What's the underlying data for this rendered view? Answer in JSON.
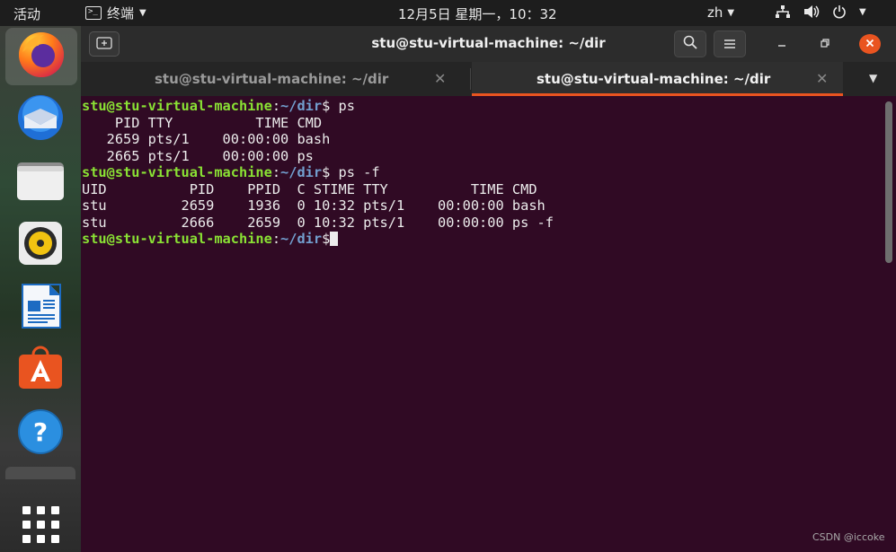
{
  "topbar": {
    "activities": "活动",
    "app_name": "终端",
    "clock": "12月5日 星期一，10：32",
    "language": "zh"
  },
  "dock": {
    "items": [
      "firefox-icon",
      "thunderbird-icon",
      "files-icon",
      "rhythmbox-icon",
      "libreoffice-writer-icon",
      "ubuntu-software-icon",
      "help-icon"
    ]
  },
  "window": {
    "title": "stu@stu-virtual-machine: ~/dir",
    "tabs": [
      {
        "label": "stu@stu-virtual-machine: ~/dir",
        "active": false
      },
      {
        "label": "stu@stu-virtual-machine: ~/dir",
        "active": true
      }
    ]
  },
  "terminal": {
    "prompt_user": "stu@stu-virtual-machine",
    "prompt_path": "~/dir",
    "command1": "ps",
    "ps_header": "    PID TTY          TIME CMD",
    "ps_rows": [
      "   2659 pts/1    00:00:00 bash",
      "   2665 pts/1    00:00:00 ps"
    ],
    "command2": "ps -f",
    "psf_header": "UID          PID    PPID  C STIME TTY          TIME CMD",
    "psf_rows": [
      "stu         2659    1936  0 10:32 pts/1    00:00:00 bash",
      "stu         2666    2659  0 10:32 pts/1    00:00:00 ps -f"
    ]
  },
  "watermark": "CSDN @iccoke",
  "colors": {
    "terminal_bg": "#300a24",
    "prompt_user": "#8ae234",
    "prompt_path": "#729fcf",
    "accent": "#e95420"
  }
}
